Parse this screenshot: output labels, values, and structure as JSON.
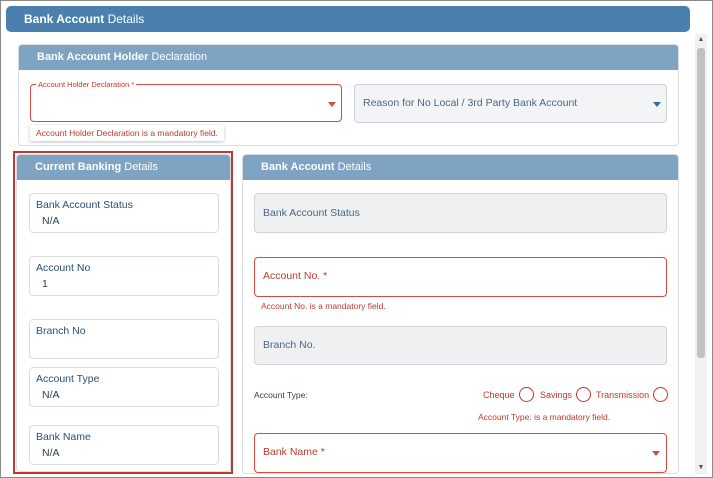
{
  "header": {
    "title_bold": "Bank Account",
    "title_rest": " Details"
  },
  "declaration_panel": {
    "title_bold": "Bank Account Holder",
    "title_rest": " Declaration",
    "holder_select": {
      "legend": "Account Holder Declaration *",
      "value": "",
      "error": "Account Holder Declaration is a mandatory field."
    },
    "reason_select": {
      "placeholder": "Reason for No Local / 3rd Party Bank Account"
    }
  },
  "current_panel": {
    "title_bold": "Current Banking",
    "title_rest": " Details",
    "fields": [
      {
        "label": "Bank Account Status",
        "value": "N/A"
      },
      {
        "label": "Account No",
        "value": "1"
      },
      {
        "label": "Branch No",
        "value": ""
      },
      {
        "label": "Account Type",
        "value": "N/A"
      },
      {
        "label": "Bank Name",
        "value": "N/A"
      }
    ]
  },
  "bank_panel": {
    "title_bold": "Bank Account",
    "title_rest": " Details",
    "status_placeholder": "Bank Account Status",
    "account_no": {
      "placeholder": "Account No. *",
      "error": "Account No. is a mandatory field."
    },
    "branch_placeholder": "Branch No.",
    "account_type": {
      "label": "Account Type:",
      "options": [
        "Cheque",
        "Savings",
        "Transmission"
      ],
      "error": "Account Type: is a mandatory field."
    },
    "bank_name": {
      "placeholder": "Bank Name *"
    }
  },
  "colors": {
    "header": "#4a7fae",
    "panel_header": "#7ea3c3",
    "error": "#c0392b",
    "highlight_outline": "#c0392b"
  },
  "icons": {
    "dropdown": "caret-down-icon",
    "radio": "radio-unchecked-icon"
  }
}
